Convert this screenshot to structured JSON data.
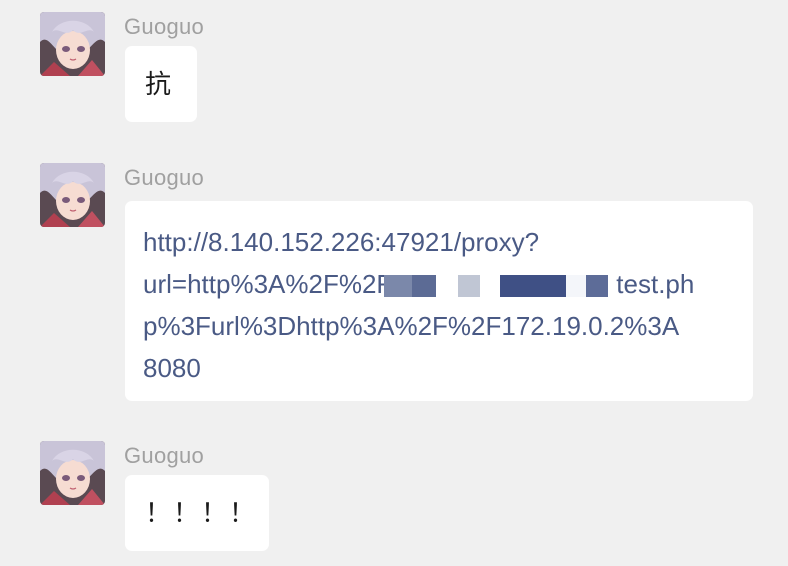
{
  "messages": [
    {
      "sender": "Guoguo",
      "avatar_icon": "anime-avatar-icon",
      "text": "抗"
    },
    {
      "sender": "Guoguo",
      "avatar_icon": "anime-avatar-icon",
      "link": {
        "line1": "http://8.140.152.226:47921/proxy?",
        "line2_prefix": "url=http%3A%2F%2F",
        "line2_suffix": "test.ph",
        "line3": "p%3Furl%3Dhttp%3A%2F%2F172.19.0.2%3A",
        "line4": "8080"
      }
    },
    {
      "sender": "Guoguo",
      "avatar_icon": "anime-avatar-icon",
      "text": "！！！！"
    }
  ],
  "colors": {
    "background": "#f0f0f0",
    "bubble": "#ffffff",
    "sender": "#a0a0a0",
    "link": "#4a5a85"
  }
}
